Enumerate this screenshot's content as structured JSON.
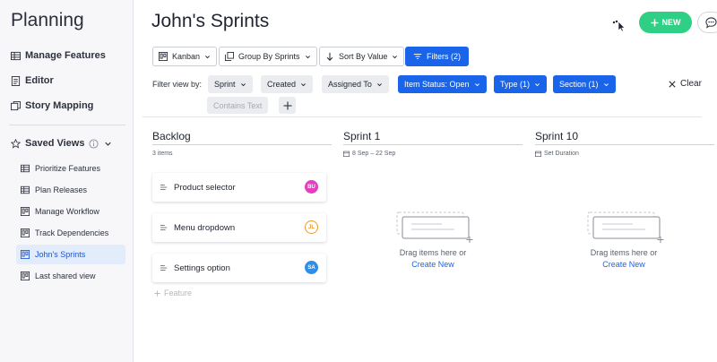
{
  "sidebar": {
    "title": "Planning",
    "items": [
      {
        "label": "Manage Features",
        "icon": "table-icon"
      },
      {
        "label": "Editor",
        "icon": "document-icon"
      },
      {
        "label": "Story Mapping",
        "icon": "map-icon"
      }
    ],
    "saved_views": {
      "label": "Saved Views",
      "items": [
        {
          "label": "Prioritize Features",
          "icon": "table-icon"
        },
        {
          "label": "Plan Releases",
          "icon": "table-icon"
        },
        {
          "label": "Manage Workflow",
          "icon": "kanban-icon"
        },
        {
          "label": "Track Dependencies",
          "icon": "kanban-icon"
        },
        {
          "label": "John's Sprints",
          "icon": "kanban-icon",
          "active": true
        },
        {
          "label": "Last shared view",
          "icon": "kanban-icon"
        }
      ]
    }
  },
  "header": {
    "title": "John's Sprints",
    "new_label": "NEW"
  },
  "toolbar": {
    "layout": "Kanban",
    "group": "Group By Sprints",
    "sort": "Sort By Value",
    "filters": "Filters (2)"
  },
  "filters": {
    "label": "Filter view by:",
    "chips": [
      {
        "label": "Sprint",
        "active": false
      },
      {
        "label": "Created",
        "active": false
      },
      {
        "label": "Assigned To",
        "active": false
      },
      {
        "label": "Item Status: Open",
        "active": true
      },
      {
        "label": "Type (1)",
        "active": true
      },
      {
        "label": "Section (1)",
        "active": true
      }
    ],
    "contains_text": "Contains Text",
    "clear_label": "Clear"
  },
  "columns": {
    "backlog": {
      "title": "Backlog",
      "count": "3 items",
      "cards": [
        {
          "label": "Product selector",
          "initials": "BU",
          "color": "#e33fbf"
        },
        {
          "label": "Menu dropdown",
          "initials": "JL",
          "color": "#ec9a2a"
        },
        {
          "label": "Settings option",
          "initials": "SA",
          "color": "#2f8ee6"
        }
      ],
      "add_label": "Feature"
    },
    "sprint1": {
      "title": "Sprint 1",
      "dates": "8 Sep – 22 Sep",
      "empty_text": "Drag items here or",
      "create_text": "Create New"
    },
    "sprint10": {
      "title": "Sprint 10",
      "dates": "Set Duration",
      "empty_text": "Drag items here or",
      "create_text": "Create New"
    }
  },
  "colors": {
    "accent": "#1a64ea",
    "new_button": "#2fcf86"
  }
}
